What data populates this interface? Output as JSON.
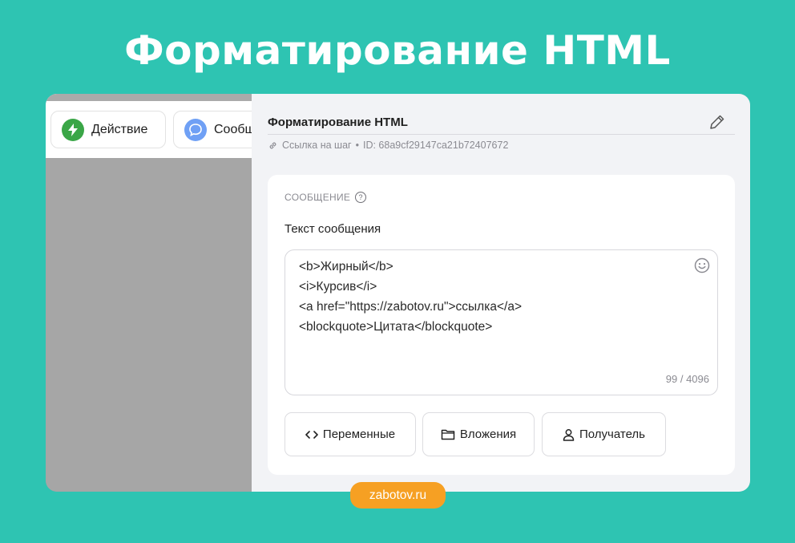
{
  "headline": "Форматирование HTML",
  "canvas": {
    "nodes": [
      {
        "label": "Действие",
        "icon": "lightning-icon",
        "color": "#3aa647"
      },
      {
        "label": "Сообщ",
        "icon": "chat-bubble-icon",
        "color": "#6fa0f5"
      }
    ]
  },
  "panel": {
    "step_title": "Форматирование HTML",
    "link_label": "Ссылка на шаг",
    "separator": "•",
    "id_text": "ID: 68a9cf29147ca21b72407672",
    "section_label": "СООБЩЕНИЕ",
    "help_glyph": "?",
    "field_label": "Текст сообщения",
    "message_lines": [
      "<b>Жирный</b>",
      "<i>Курсив</i>",
      "<a href=\"https://zabotov.ru\">ссылка</a>",
      "<blockquote>Цитата</blockquote>"
    ],
    "counter": "99 / 4096",
    "buttons": [
      {
        "label": "Переменные",
        "icon": "code-brackets-icon"
      },
      {
        "label": "Вложения",
        "icon": "folder-icon"
      },
      {
        "label": "Получатель",
        "icon": "user-icon"
      }
    ]
  },
  "badge": "zabotov.ru",
  "colors": {
    "background": "#2ec4b2",
    "badge": "#f6a023",
    "action_icon": "#3aa647",
    "message_icon": "#6fa0f5"
  }
}
